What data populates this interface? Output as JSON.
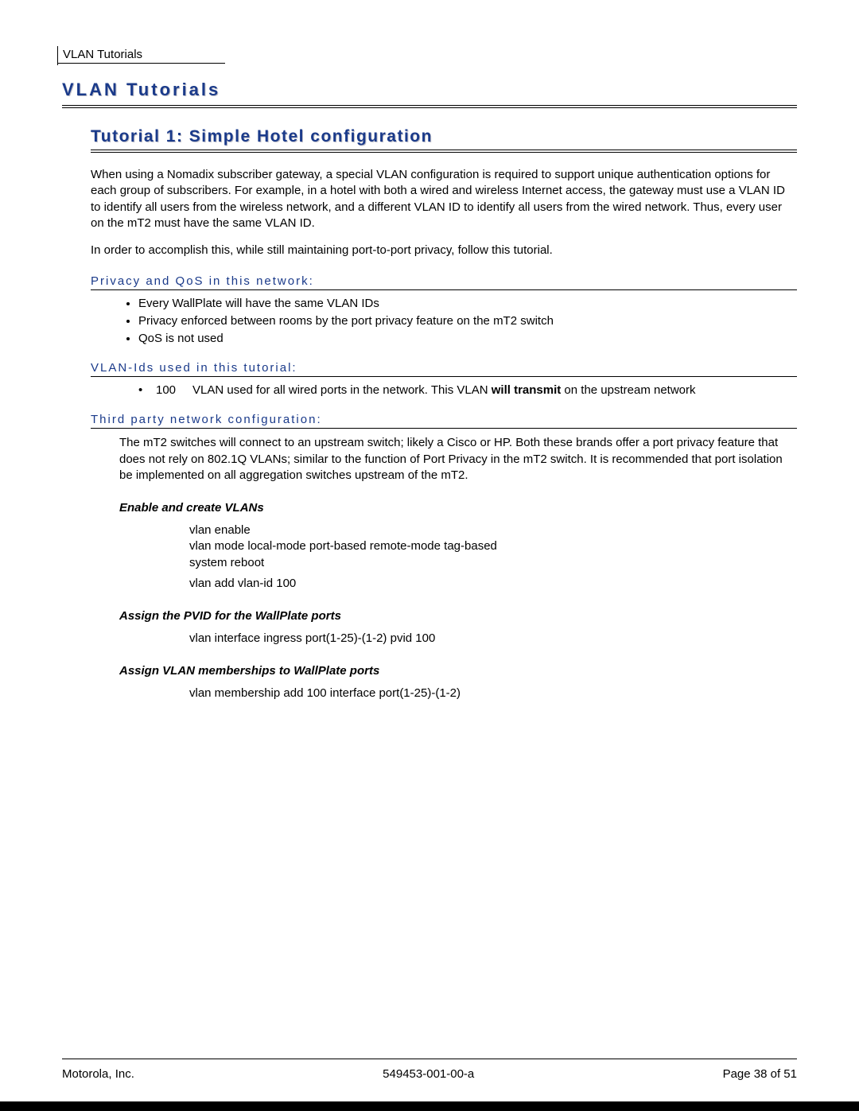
{
  "header": {
    "running": "VLAN Tutorials"
  },
  "h1": "VLAN Tutorials",
  "h2": "Tutorial 1:  Simple Hotel configuration",
  "intro1": "When using a Nomadix subscriber gateway, a special VLAN configuration is required to support unique authentication options for each group of subscribers.  For example, in a hotel with both a wired and wireless Internet access, the gateway must use a VLAN ID to identify all users from the wireless network, and a different VLAN ID to identify all users from the wired network.  Thus, every user on the mT2 must have the same VLAN ID.",
  "intro2": "In order to accomplish this, while still maintaining port-to-port privacy, follow this tutorial.",
  "sections": {
    "privacy": {
      "title": "Privacy and QoS in this network:",
      "bullets": [
        "Every WallPlate will have the same VLAN IDs",
        "Privacy enforced between rooms by the port privacy feature on the mT2 switch",
        "QoS is not used"
      ]
    },
    "vlanids": {
      "title": "VLAN-Ids used in this tutorial:",
      "rows": [
        {
          "id": "100",
          "desc_pre": "VLAN used for all wired ports in the network.  This VLAN ",
          "desc_bold": "will transmit",
          "desc_post": " on the upstream network"
        }
      ]
    },
    "thirdparty": {
      "title": "Third party network configuration:",
      "body": "The mT2 switches will connect to an upstream switch; likely a Cisco or HP.  Both these brands offer a port privacy feature that does not rely on 802.1Q VLANs; similar to the function of Port Privacy in the mT2 switch.  It is recommended that port isolation be implemented on all aggregation switches upstream of the mT2."
    }
  },
  "steps": [
    {
      "title": "Enable and create VLANs",
      "blocks": [
        "vlan enable\nvlan mode local-mode port-based remote-mode tag-based\nsystem reboot",
        "vlan add vlan-id 100"
      ]
    },
    {
      "title": "Assign the PVID for the WallPlate ports",
      "blocks": [
        "vlan interface ingress port(1-25)-(1-2) pvid 100"
      ]
    },
    {
      "title": "Assign VLAN memberships to WallPlate ports",
      "blocks": [
        "vlan membership add 100 interface port(1-25)-(1-2)"
      ]
    }
  ],
  "footer": {
    "left": "Motorola, Inc.",
    "center": "549453-001-00-a",
    "right": "Page 38 of 51"
  }
}
